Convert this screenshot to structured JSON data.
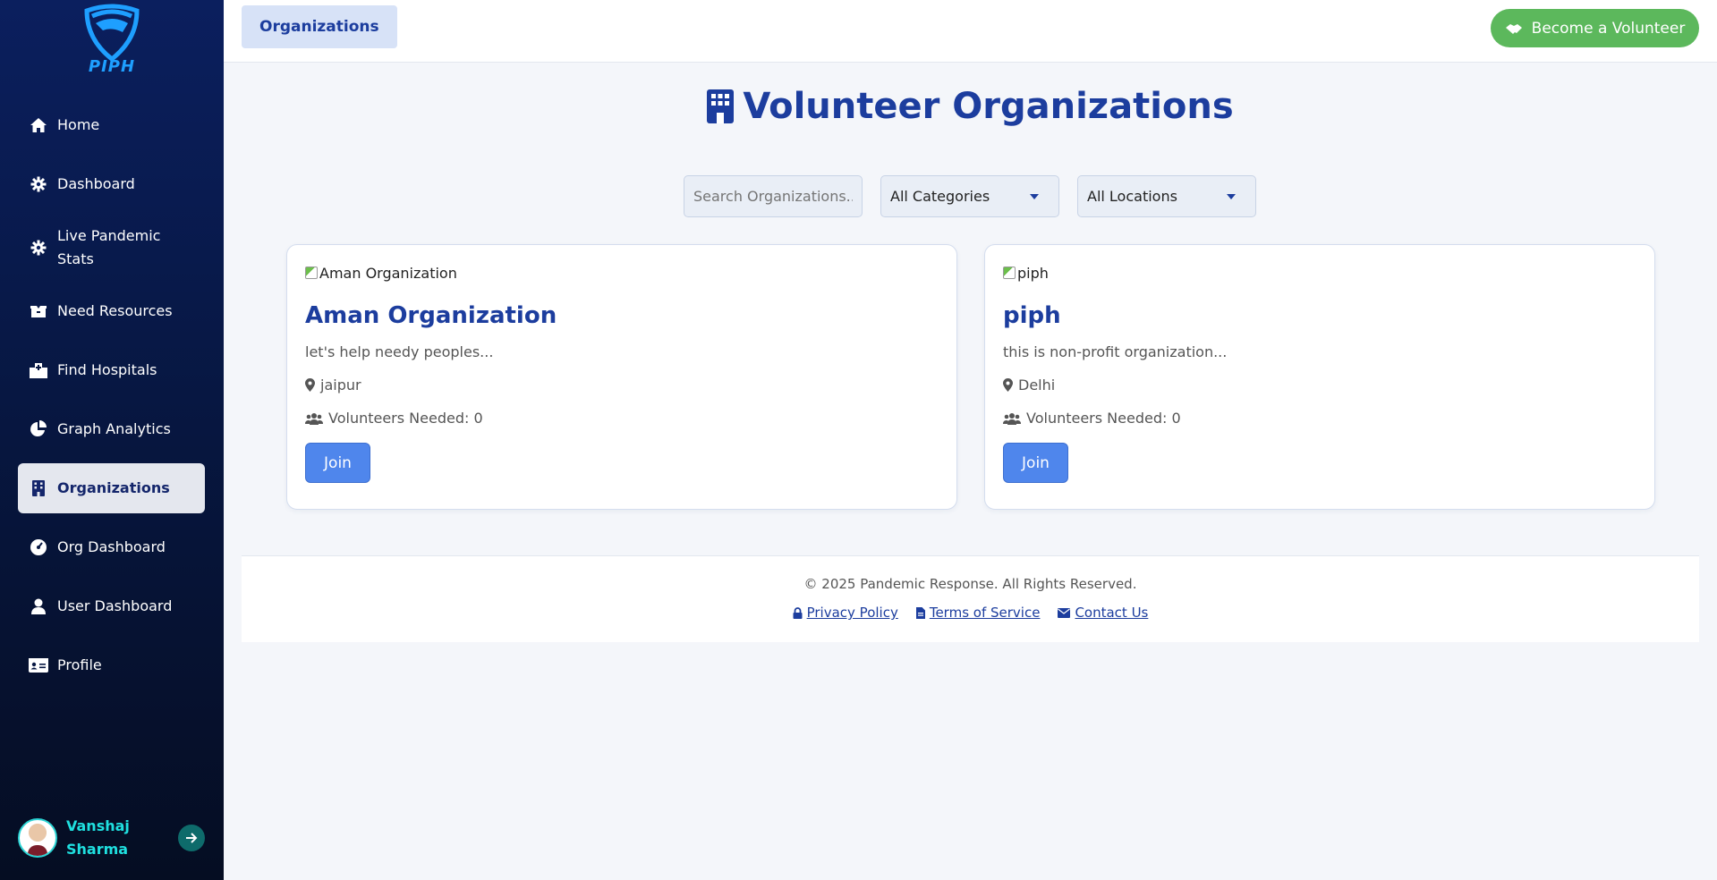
{
  "sidebar": {
    "logo_text": "PIPH",
    "items": [
      {
        "label": "Home",
        "icon": "home-icon"
      },
      {
        "label": "Dashboard",
        "icon": "gear-icon"
      },
      {
        "label": "Live Pandemic Stats",
        "icon": "gear-icon"
      },
      {
        "label": "Need Resources",
        "icon": "box-icon"
      },
      {
        "label": "Find Hospitals",
        "icon": "hospital-icon"
      },
      {
        "label": "Graph Analytics",
        "icon": "pie-chart-icon"
      },
      {
        "label": "Organizations",
        "icon": "building-icon",
        "active": true
      },
      {
        "label": "Org Dashboard",
        "icon": "gauge-icon"
      },
      {
        "label": "User Dashboard",
        "icon": "user-icon"
      },
      {
        "label": "Profile",
        "icon": "id-card-icon"
      }
    ],
    "user": {
      "name": "Vanshaj Sharma"
    }
  },
  "topbar": {
    "breadcrumb": "Organizations",
    "volunteer_label": "Become a Volunteer"
  },
  "main": {
    "title": "Volunteer Organizations",
    "search_placeholder": "Search Organizations..",
    "category_selected": "All Categories",
    "location_selected": "All Locations",
    "cards": [
      {
        "image_alt": "Aman Organization",
        "name": "Aman Organization",
        "description": "let's help needy peoples...",
        "location": "jaipur",
        "volunteers": "Volunteers Needed: 0",
        "join_label": "Join"
      },
      {
        "image_alt": "piph",
        "name": "piph",
        "description": "this is non-profit organization...",
        "location": "Delhi",
        "volunteers": "Volunteers Needed: 0",
        "join_label": "Join"
      }
    ]
  },
  "footer": {
    "copyright": "© 2025 Pandemic Response. All Rights Reserved.",
    "links": [
      "Privacy Policy",
      "Terms of Service",
      "Contact Us"
    ]
  },
  "colors": {
    "accent": "#1c3d9e",
    "sidebar": "#071742",
    "success": "#5cb85c",
    "join": "#4f86ec"
  }
}
